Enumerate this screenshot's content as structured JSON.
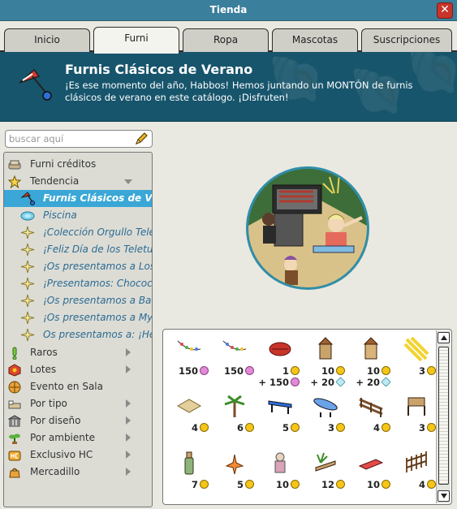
{
  "window": {
    "title": "Tienda",
    "close_label": "✕"
  },
  "tabs": [
    {
      "label": "Inicio",
      "active": false
    },
    {
      "label": "Furni",
      "active": true
    },
    {
      "label": "Ropa",
      "active": false
    },
    {
      "label": "Mascotas",
      "active": false
    },
    {
      "label": "Suscripciones",
      "active": false
    }
  ],
  "banner": {
    "title": "Furnis Clásicos de Verano",
    "description": "¡Es ese momento del año, Habbos! Hemos juntando un MONTÓN de furnis clásicos de verano en este catálogo. ¡Disfruten!",
    "icon": "umbrella-icon"
  },
  "search": {
    "placeholder": "buscar aquí",
    "value": ""
  },
  "nav": {
    "top_items": [
      {
        "label": "Furni créditos",
        "icon": "couch-icon",
        "arrow": "none"
      },
      {
        "label": "Tendencia",
        "icon": "star-icon",
        "arrow": "down"
      }
    ],
    "sub_items": [
      {
        "label": "Furnis Clásicos de Verano",
        "icon": "umbrella-icon",
        "selected": true
      },
      {
        "label": "Piscina",
        "icon": "pool-icon",
        "selected": false
      },
      {
        "label": "¡Colección Orgullo Teletubbies",
        "icon": "sparkle-icon",
        "selected": false
      },
      {
        "label": "¡Feliz Día de los Teletubbies",
        "icon": "sparkle-icon",
        "selected": false
      },
      {
        "label": "¡Os presentamos a Los Teletubbies",
        "icon": "sparkle-icon",
        "selected": false
      },
      {
        "label": "¡Presentamos: Chococat",
        "icon": "sparkle-icon",
        "selected": false
      },
      {
        "label": "¡Os presentamos a Badtz-Maru",
        "icon": "sparkle-icon",
        "selected": false
      },
      {
        "label": "¡Os presentamos a My Melody",
        "icon": "sparkle-icon",
        "selected": false
      },
      {
        "label": "Os presentamos a: ¡Hello Kitty",
        "icon": "sparkle-icon",
        "selected": false
      }
    ],
    "bottom_items": [
      {
        "label": "Raros",
        "icon": "exclamation-icon"
      },
      {
        "label": "Lotes",
        "icon": "bundle-icon"
      },
      {
        "label": "Evento en Sala",
        "icon": "globe-icon"
      },
      {
        "label": "Por tipo",
        "icon": "bed-icon"
      },
      {
        "label": "Por diseño",
        "icon": "building-icon"
      },
      {
        "label": "Por ambiente",
        "icon": "plant-icon"
      },
      {
        "label": "Exclusivo HC",
        "icon": "hc-icon"
      },
      {
        "label": "Mercadillo",
        "icon": "market-icon"
      }
    ]
  },
  "preview": {
    "icon": "room-preview-image"
  },
  "items": [
    {
      "icon": "string-lights-icon",
      "price": "150",
      "currency": "pink"
    },
    {
      "icon": "string-lights-icon",
      "price": "150",
      "currency": "pink"
    },
    {
      "icon": "bbq-grill-icon",
      "price": "1",
      "currency": "coin",
      "price2": "+ 150",
      "currency2": "pink"
    },
    {
      "icon": "lantern-icon",
      "price": "10",
      "currency": "coin",
      "price2": "+ 20",
      "currency2": "diamond"
    },
    {
      "icon": "lantern-icon",
      "price": "10",
      "currency": "coin",
      "price2": "+ 20",
      "currency2": "diamond"
    },
    {
      "icon": "sunlight-icon",
      "price": "3",
      "currency": "coin"
    },
    {
      "icon": "sand-tile-icon",
      "price": "4",
      "currency": "coin"
    },
    {
      "icon": "palm-tree-icon",
      "price": "6",
      "currency": "coin"
    },
    {
      "icon": "bench-icon",
      "price": "5",
      "currency": "coin"
    },
    {
      "icon": "surfboard-icon",
      "price": "3",
      "currency": "coin"
    },
    {
      "icon": "fence-icon",
      "price": "4",
      "currency": "coin"
    },
    {
      "icon": "chair-icon",
      "price": "3",
      "currency": "coin"
    },
    {
      "icon": "bottle-icon",
      "price": "7",
      "currency": "coin"
    },
    {
      "icon": "starfish-icon",
      "price": "5",
      "currency": "coin"
    },
    {
      "icon": "statue-icon",
      "price": "10",
      "currency": "coin"
    },
    {
      "icon": "plant-bench-icon",
      "price": "12",
      "currency": "coin"
    },
    {
      "icon": "sunbed-icon",
      "price": "10",
      "currency": "coin"
    },
    {
      "icon": "gate-icon",
      "price": "4",
      "currency": "coin"
    }
  ]
}
